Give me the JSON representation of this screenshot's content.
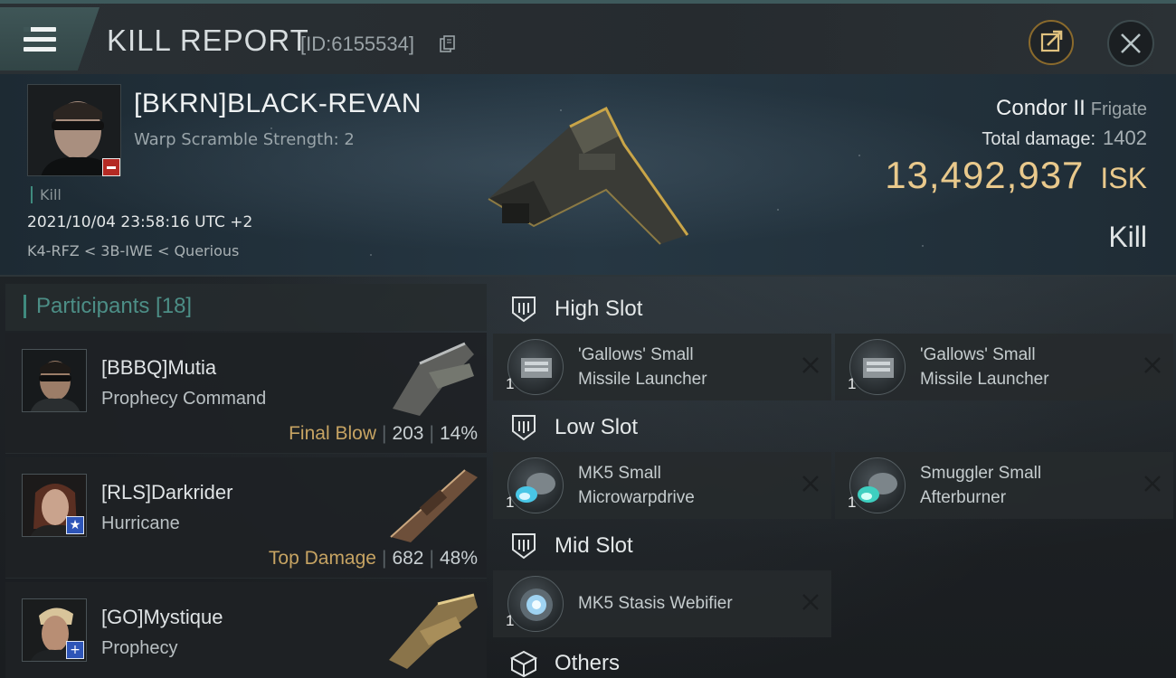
{
  "header": {
    "title": "KILL REPORT",
    "kill_id": "[ID:6155534]"
  },
  "victim": {
    "name": "[BKRN]BLACK-REVAN",
    "subtitle": "Warp Scramble Strength: 2",
    "tag": "Kill",
    "datetime": "2021/10/04 23:58:16 UTC +2",
    "location": "K4-RFZ < 3B-IWE < Querious",
    "ship_name": "Condor II",
    "ship_class": "Frigate",
    "total_damage_label": "Total damage:",
    "total_damage": "1402",
    "isk_value": "13,492,937",
    "isk_unit": "ISK",
    "result": "Kill"
  },
  "participants": {
    "title": "Participants [18]",
    "rows": [
      {
        "name": "[BBBQ]Mutia",
        "ship": "Prophecy Command",
        "tag": "Final Blow",
        "damage": "203",
        "percent": "14%",
        "badge": ""
      },
      {
        "name": "[RLS]Darkrider",
        "ship": "Hurricane",
        "tag": "Top Damage",
        "damage": "682",
        "percent": "48%",
        "badge": "★"
      },
      {
        "name": "[GO]Mystique",
        "ship": "Prophecy",
        "tag": "",
        "damage": "",
        "percent": "",
        "badge": "+"
      }
    ]
  },
  "fitting": {
    "high": {
      "title": "High Slot",
      "modules": [
        {
          "line1": "'Gallows' Small",
          "line2": "Missile Launcher",
          "qty": "1"
        },
        {
          "line1": "'Gallows' Small",
          "line2": "Missile Launcher",
          "qty": "1"
        }
      ]
    },
    "low": {
      "title": "Low Slot",
      "modules": [
        {
          "line1": "MK5 Small",
          "line2": "Microwarpdrive",
          "qty": "1"
        },
        {
          "line1": "Smuggler Small",
          "line2": "Afterburner",
          "qty": "1"
        }
      ]
    },
    "mid": {
      "title": "Mid Slot",
      "modules": [
        {
          "line1": "MK5 Stasis Webifier",
          "qty": "1"
        }
      ]
    },
    "others": {
      "title": "Others"
    }
  },
  "colors": {
    "isk_gold": "#e9c98c",
    "teal_accent": "#3f8a7e",
    "tag_gold": "#c7a463"
  }
}
